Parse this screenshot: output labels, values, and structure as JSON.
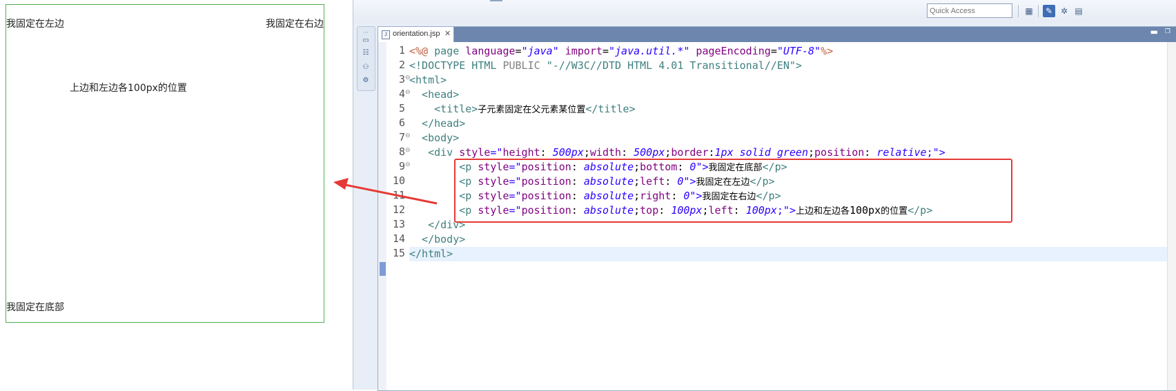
{
  "preview": {
    "left_text": "我固定在左边",
    "right_text": "我固定在右边",
    "positioned_text": "上边和左边各100px的位置",
    "bottom_text": "我固定在底部"
  },
  "toolbar": {
    "quick_access_placeholder": "Quick Access"
  },
  "editor": {
    "tab_label": "orientation.jsp",
    "tab_close": "✕",
    "line_numbers": [
      "1",
      "2",
      "3",
      "4",
      "5",
      "6",
      "7",
      "8",
      "9",
      "10",
      "11",
      "12",
      "13",
      "14",
      "15"
    ],
    "lines": {
      "l1": {
        "a": "<%@ ",
        "b": "page ",
        "c": "language",
        "d": "=",
        "e": "\"java\"",
        "f": " import",
        "g": "=",
        "h": "\"java.util.*\"",
        "i": " pageEncoding",
        "j": "=",
        "k": "\"UTF-8\"",
        "l": "%>"
      },
      "l2": {
        "a": "<!DOCTYPE HTML ",
        "b": "PUBLIC ",
        "c": "\"-//W3C//DTD HTML 4.01 Transitional//EN\"",
        "d": ">"
      },
      "l3": {
        "a": "<html>"
      },
      "l4": {
        "a": "  <head>"
      },
      "l5": {
        "a": "    <title>",
        "b": "子元素固定在父元素某位置",
        "c": "</title>"
      },
      "l6": {
        "a": "  </head>"
      },
      "l7": {
        "a": "  <body>"
      },
      "l8": {
        "a": "   <div ",
        "b": "style",
        "c": "=\"",
        "d": "height",
        "e": ": ",
        "f": "500px",
        "g": ";",
        "h": "width",
        "i": ": ",
        "j": "500px",
        "k": ";",
        "l": "border",
        "m": ":",
        "n": "1px solid green",
        "o": ";",
        "p": "position",
        "q": ": ",
        "r": "relative",
        "s": ";\">"
      },
      "l9": {
        "a": "        <p ",
        "b": "style",
        "c": "=\"",
        "d": "position",
        "e": ": ",
        "f": "absolute",
        "g": ";",
        "h": "bottom",
        "i": ": ",
        "j": "0",
        "k": "\">",
        "l": "我固定在底部",
        "m": "</p>"
      },
      "l10": {
        "a": "        <p ",
        "b": "style",
        "c": "=\"",
        "d": "position",
        "e": ": ",
        "f": "absolute",
        "g": ";",
        "h": "left",
        "i": ": ",
        "j": "0",
        "k": "\">",
        "l": "我固定在左边",
        "m": "</p>"
      },
      "l11": {
        "a": "        <p ",
        "b": "style",
        "c": "=\"",
        "d": "position",
        "e": ": ",
        "f": "absolute",
        "g": ";",
        "h": "right",
        "i": ": ",
        "j": "0",
        "k": "\">",
        "l": "我固定在右边",
        "m": "</p>"
      },
      "l12": {
        "a": "        <p ",
        "b": "style",
        "c": "=\"",
        "d": "position",
        "e": ": ",
        "f": "absolute",
        "g": ";",
        "h": "top",
        "i": ": ",
        "j": "100px",
        "k": ";",
        "l": "left",
        "m": ": ",
        "n": "100px",
        "o": ";\">",
        "p": "上边和左边各",
        "q": "100px",
        "r": "的位置",
        "s": "</p>"
      },
      "l13": {
        "a": "   </div>"
      },
      "l14": {
        "a": "  </body>"
      },
      "l15": {
        "a": "</html>"
      }
    }
  },
  "colors": {
    "tag": "#3f7f7f",
    "attribute": "#7f007f",
    "value": "#2a00ff",
    "annotation_red": "#e53935",
    "preview_border": "#4caf50"
  }
}
